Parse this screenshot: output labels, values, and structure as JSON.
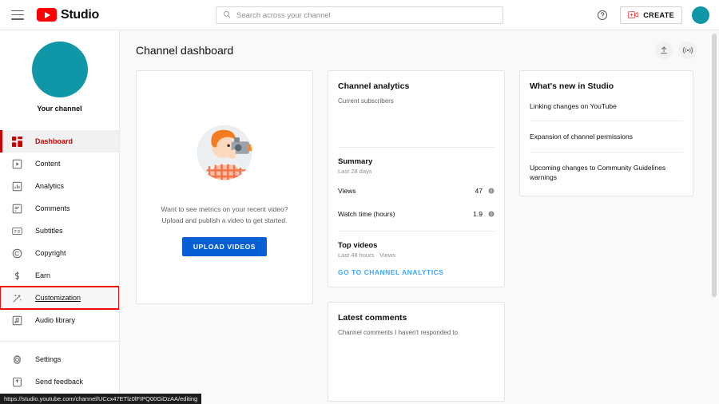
{
  "header": {
    "brand": "Studio",
    "menu_icon": "hamburger-menu-icon",
    "logo_icon": "youtube-logo-icon",
    "search_placeholder": "Search across your channel",
    "search_value": "",
    "search_icon": "search-icon",
    "help_icon": "help-question-icon",
    "create_label": "CREATE",
    "create_icon": "video-camera-plus-icon",
    "avatar_color": "#0f97a8"
  },
  "sidebar": {
    "channel_label": "Your channel",
    "avatar_color": "#0f97a8",
    "items": [
      {
        "label": "Dashboard",
        "icon": "dashboard-grid-icon",
        "active": true,
        "hovered": false,
        "highlighted": false
      },
      {
        "label": "Content",
        "icon": "play-box-icon",
        "active": false,
        "hovered": false,
        "highlighted": false
      },
      {
        "label": "Analytics",
        "icon": "bar-chart-icon",
        "active": false,
        "hovered": false,
        "highlighted": false
      },
      {
        "label": "Comments",
        "icon": "comment-icon",
        "active": false,
        "hovered": false,
        "highlighted": false
      },
      {
        "label": "Subtitles",
        "icon": "subtitles-icon",
        "active": false,
        "hovered": false,
        "highlighted": false
      },
      {
        "label": "Copyright",
        "icon": "copyright-icon",
        "active": false,
        "hovered": false,
        "highlighted": false
      },
      {
        "label": "Earn",
        "icon": "dollar-sign-icon",
        "active": false,
        "hovered": false,
        "highlighted": false
      },
      {
        "label": "Customization",
        "icon": "magic-wand-icon",
        "active": false,
        "hovered": true,
        "highlighted": true
      },
      {
        "label": "Audio library",
        "icon": "music-note-box-icon",
        "active": false,
        "hovered": false,
        "highlighted": false
      }
    ],
    "footer_items": [
      {
        "label": "Settings",
        "icon": "gear-icon"
      },
      {
        "label": "Send feedback",
        "icon": "feedback-icon"
      }
    ]
  },
  "main": {
    "page_title": "Channel dashboard",
    "actions": [
      {
        "name": "upload-video",
        "icon": "upload-arrow-icon"
      },
      {
        "name": "go-live",
        "icon": "broadcast-live-icon"
      }
    ],
    "upload_card": {
      "illustration": "creator-with-camera-illustration",
      "text_line1": "Want to see metrics on your recent video?",
      "text_line2": "Upload and publish a video to get started.",
      "button_label": "UPLOAD VIDEOS"
    },
    "analytics_card": {
      "title": "Channel analytics",
      "subscribers_label": "Current subscribers",
      "summary_title": "Summary",
      "summary_period": "Last 28 days",
      "metrics": [
        {
          "label": "Views",
          "value": "47",
          "info_icon": "info-circle-icon"
        },
        {
          "label": "Watch time (hours)",
          "value": "1.9",
          "info_icon": "info-circle-icon"
        }
      ],
      "top_videos_title": "Top videos",
      "top_videos_sub": "Last 48 hours · Views",
      "link_label": "GO TO CHANNEL ANALYTICS"
    },
    "comments_card": {
      "title": "Latest comments",
      "subtitle": "Channel comments I haven't responded to"
    },
    "news_card": {
      "title": "What's new in Studio",
      "items": [
        "Linking changes on YouTube",
        "Expansion of channel permissions",
        "Upcoming changes to Community Guidelines warnings"
      ]
    }
  },
  "status_bar": {
    "url": "https://studio.youtube.com/channel/UCcx47ETlz0lFIPQ00GiDzAA/editing"
  },
  "colors": {
    "brand_red": "#ff0000",
    "active_red": "#cc0000",
    "link_blue": "#3ea6ff",
    "button_blue": "#065fd4",
    "teal_avatar": "#0f97a8",
    "highlight_box": "#f20d0d"
  }
}
